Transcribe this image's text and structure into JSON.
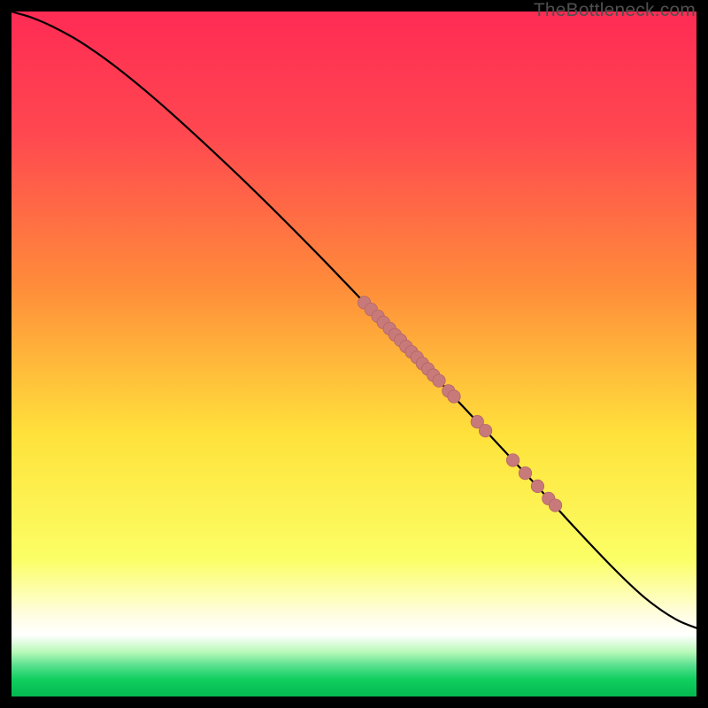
{
  "watermark": "TheBottleneck.com",
  "colors": {
    "top": "#ff2b54",
    "mid_upper": "#ff8c3a",
    "mid": "#ffe23b",
    "lower_mid": "#fbff65",
    "cream": "#fffde0",
    "green_pale": "#b8f9b8",
    "green_mid": "#58e08e",
    "green_deep": "#10cf5f",
    "curve": "#000000",
    "point_fill": "#c87a7a",
    "point_stroke": "#b36666"
  },
  "chart_data": {
    "type": "line",
    "title": "",
    "xlabel": "",
    "ylabel": "",
    "x_range": [
      0,
      100
    ],
    "y_range": [
      0,
      100
    ],
    "curve": [
      {
        "x": 0,
        "y": 100
      },
      {
        "x": 1,
        "y": 99.7
      },
      {
        "x": 3,
        "y": 99.1
      },
      {
        "x": 6,
        "y": 97.8
      },
      {
        "x": 10,
        "y": 95.6
      },
      {
        "x": 15,
        "y": 92.1
      },
      {
        "x": 21,
        "y": 87.2
      },
      {
        "x": 28,
        "y": 80.9
      },
      {
        "x": 36,
        "y": 73.3
      },
      {
        "x": 44,
        "y": 65.3
      },
      {
        "x": 52,
        "y": 57.0
      },
      {
        "x": 60,
        "y": 48.6
      },
      {
        "x": 68,
        "y": 40.1
      },
      {
        "x": 76,
        "y": 31.5
      },
      {
        "x": 82,
        "y": 24.9
      },
      {
        "x": 88,
        "y": 18.6
      },
      {
        "x": 92,
        "y": 14.8
      },
      {
        "x": 95,
        "y": 12.5
      },
      {
        "x": 97.5,
        "y": 11.0
      },
      {
        "x": 100,
        "y": 10.0
      }
    ],
    "points_cluster_a": [
      {
        "x": 51.5,
        "y": 57.5
      },
      {
        "x": 52.5,
        "y": 56.5
      },
      {
        "x": 53.5,
        "y": 55.5
      },
      {
        "x": 54.3,
        "y": 54.6
      },
      {
        "x": 55.2,
        "y": 53.7
      },
      {
        "x": 56.0,
        "y": 52.8
      },
      {
        "x": 56.8,
        "y": 52.0
      },
      {
        "x": 57.6,
        "y": 51.1
      },
      {
        "x": 58.4,
        "y": 50.3
      },
      {
        "x": 59.2,
        "y": 49.5
      },
      {
        "x": 60.0,
        "y": 48.6
      },
      {
        "x": 60.8,
        "y": 47.8
      },
      {
        "x": 61.6,
        "y": 46.9
      },
      {
        "x": 62.4,
        "y": 46.1
      },
      {
        "x": 63.8,
        "y": 44.6
      },
      {
        "x": 64.6,
        "y": 43.8
      }
    ],
    "points_cluster_b": [
      {
        "x": 68.0,
        "y": 40.1
      },
      {
        "x": 69.2,
        "y": 38.8
      }
    ],
    "points_cluster_c": [
      {
        "x": 73.2,
        "y": 34.5
      },
      {
        "x": 75.0,
        "y": 32.6
      },
      {
        "x": 76.8,
        "y": 30.7
      },
      {
        "x": 78.4,
        "y": 28.9
      },
      {
        "x": 79.4,
        "y": 27.9
      }
    ]
  }
}
